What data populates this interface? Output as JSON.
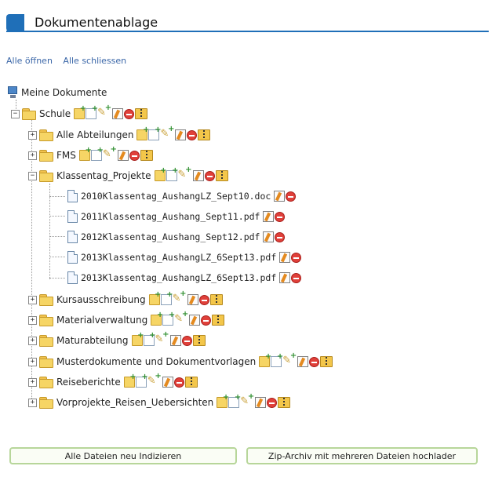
{
  "header": {
    "title": "Dokumentenablage"
  },
  "links": {
    "open_all": "Alle öffnen",
    "close_all": "Alle schliessen"
  },
  "tree": {
    "root": "Meine Dokumente",
    "schule": "Schule",
    "children": [
      "Alle Abteilungen",
      "FMS",
      "Klassentag_Projekte",
      "Kursausschreibung",
      "Materialverwaltung",
      "Maturabteilung",
      "Musterdokumente und Dokumentvorlagen",
      "Reiseberichte",
      "Vorprojekte_Reisen_Uebersichten"
    ],
    "files": [
      "2010Klassentag_AushangLZ_Sept10.doc",
      "2011Klassentag_Aushang_Sept11.pdf",
      "2012Klassentag_Aushang_Sept12.pdf",
      "2013Klassentag_AushangLZ_6Sept13.pdf",
      "2013Klassentag_AushangLZ_6Sept13.pdf"
    ],
    "toggle_collapsed": "+",
    "toggle_expanded": "−"
  },
  "buttons": {
    "reindex": "Alle Dateien neu Indizieren",
    "zip_upload": "Zip-Archiv mit mehreren Dateien hochlader"
  },
  "colors": {
    "accent": "#1f6fb8",
    "link": "#3b67a8",
    "button_border": "#b7d69a"
  },
  "icons": [
    "computer-icon",
    "folder-icon",
    "new-folder-icon",
    "new-file-icon",
    "upload-icon",
    "rename-icon",
    "delete-icon",
    "zip-icon",
    "file-icon"
  ]
}
